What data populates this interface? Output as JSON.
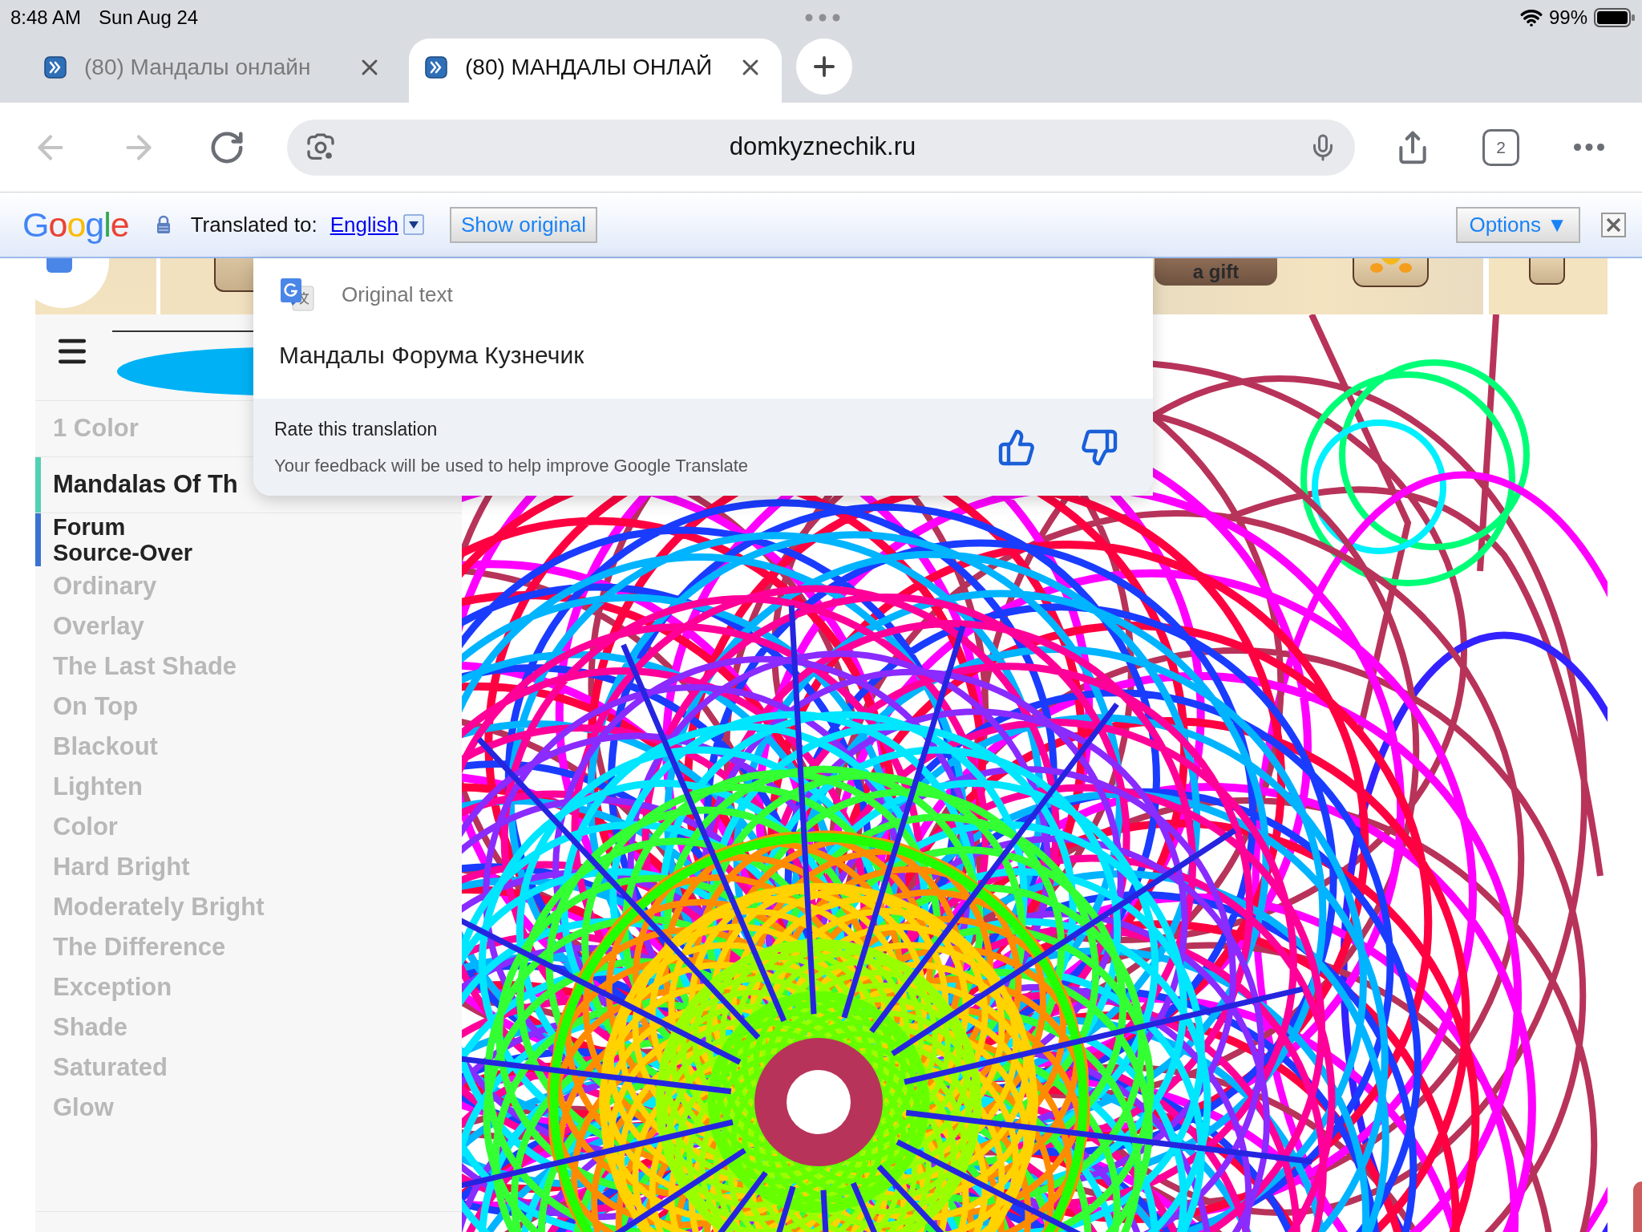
{
  "status_bar": {
    "time": "8:48 AM",
    "date": "Sun Aug 24",
    "battery": "99%"
  },
  "tabs": [
    {
      "title": "(80) Мандалы онлайн",
      "selected": false
    },
    {
      "title": "(80) МАНДАЛЫ ОНЛАЙ",
      "selected": true
    }
  ],
  "toolbar": {
    "back_disabled": true,
    "forward_disabled": true,
    "url": "domkyznechik.ru",
    "tab_count": "2"
  },
  "translate_bar": {
    "logo": "Google",
    "label": "Translated to:",
    "language": "English",
    "show_original": "Show original",
    "options": "Options ▼"
  },
  "header_strip": {
    "gift_button": "a gift"
  },
  "sidebar": {
    "heading": "1 Color",
    "sections": [
      {
        "title": "Mandalas Of Th",
        "color": "#52d0b3"
      },
      {
        "title": "Source-Over",
        "overlay_text": "Forum",
        "color": "#3a72d0"
      }
    ],
    "modes": [
      "Ordinary",
      "Overlay",
      "The Last Shade",
      "On Top",
      "Blackout",
      "Lighten",
      "Color",
      "Hard Bright",
      "Moderately Bright",
      "The Difference",
      "Exception",
      "Shade",
      "Saturated",
      "Glow"
    ]
  },
  "translation_popup": {
    "heading": "Original text",
    "original_text": "Мандалы Форума Кузнечик",
    "rating_title": "Rate this translation",
    "rating_note": "Your feedback will be used to help improve Google Translate"
  }
}
